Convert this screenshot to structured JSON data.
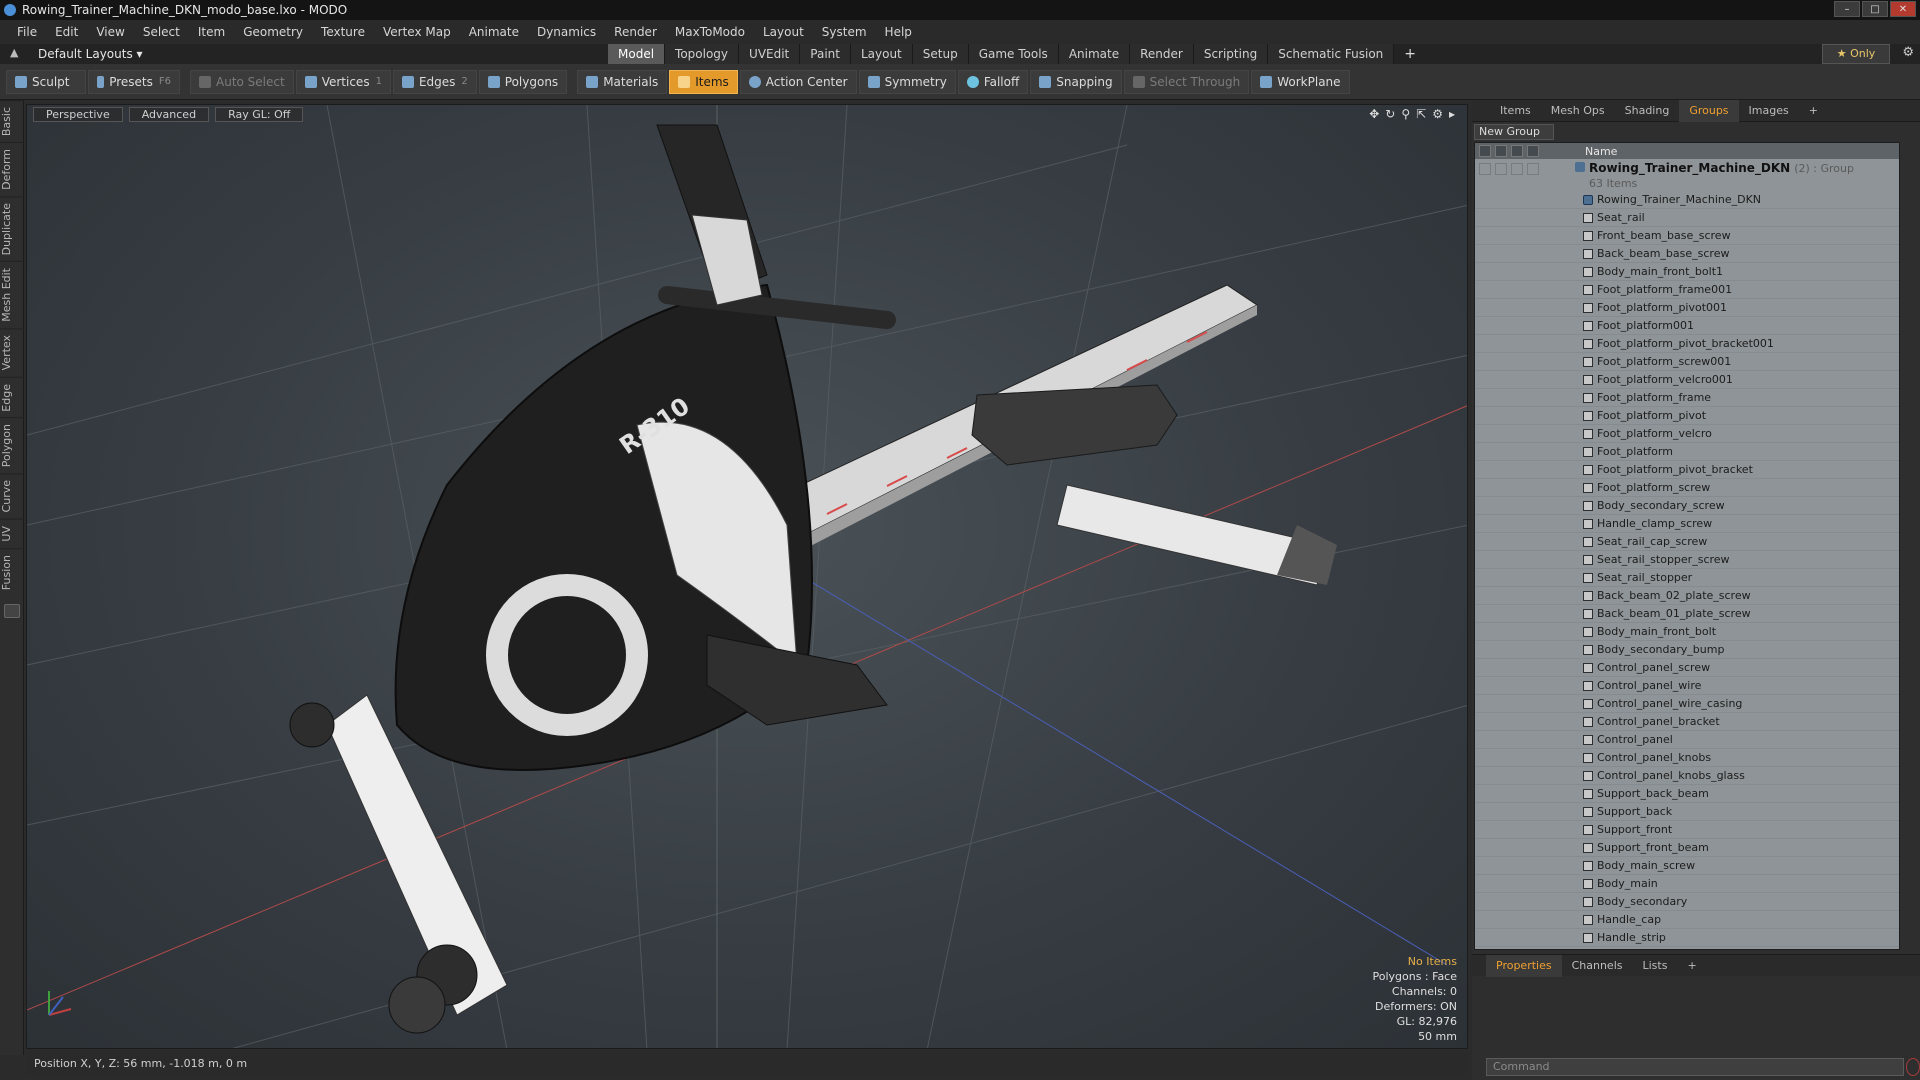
{
  "window": {
    "title": "Rowing_Trainer_Machine_DKN_modo_base.lxo - MODO"
  },
  "menu": [
    "File",
    "Edit",
    "View",
    "Select",
    "Item",
    "Geometry",
    "Texture",
    "Vertex Map",
    "Animate",
    "Dynamics",
    "Render",
    "MaxToModo",
    "Layout",
    "System",
    "Help"
  ],
  "layouts": {
    "current": "Default Layouts ▾",
    "tabs": [
      "Model",
      "Topology",
      "UVEdit",
      "Paint",
      "Layout",
      "Setup",
      "Game Tools",
      "Animate",
      "Render",
      "Scripting",
      "Schematic Fusion"
    ],
    "plus": "+",
    "only": "★ Only"
  },
  "toolbar": {
    "sculpt": "Sculpt",
    "presets": "Presets",
    "presets_key": "F6",
    "auto_select": "Auto Select",
    "vertices": "Vertices",
    "vertices_n": "1",
    "edges": "Edges",
    "edges_n": "2",
    "polygons": "Polygons",
    "materials": "Materials",
    "items": "Items",
    "action_center": "Action Center",
    "symmetry": "Symmetry",
    "falloff": "Falloff",
    "snapping": "Snapping",
    "select_through": "Select Through",
    "workplane": "WorkPlane"
  },
  "left_tools": [
    "Basic",
    "Deform",
    "Duplicate",
    "Mesh Edit",
    "Vertex",
    "Edge",
    "Polygon",
    "Curve",
    "UV",
    "Fusion"
  ],
  "viewport": {
    "view": "Perspective",
    "advanced": "Advanced",
    "raygl": "Ray GL: Off",
    "label_text": "R-310",
    "hud": {
      "no_items": "No Items",
      "polygons": "Polygons : Face",
      "channels": "Channels: 0",
      "deformers": "Deformers: ON",
      "gl": "GL: 82,976",
      "scale": "50 mm"
    }
  },
  "status": {
    "position": "Position X, Y, Z:  56 mm, -1.018 m, 0 m"
  },
  "right_panel": {
    "tabs": [
      "Items",
      "Mesh Ops",
      "Shading",
      "Groups",
      "Images"
    ],
    "active_tab": "Groups",
    "new_group": "New Group",
    "name_header": "Name",
    "root": {
      "name": "Rowing_Trainer_Machine_DKN",
      "meta": "(2) : Group",
      "sub": "63 Items"
    },
    "items": [
      "Rowing_Trainer_Machine_DKN",
      "Seat_rail",
      "Front_beam_base_screw",
      "Back_beam_base_screw",
      "Body_main_front_bolt1",
      "Foot_platform_frame001",
      "Foot_platform_pivot001",
      "Foot_platform001",
      "Foot_platform_pivot_bracket001",
      "Foot_platform_screw001",
      "Foot_platform_velcro001",
      "Foot_platform_frame",
      "Foot_platform_pivot",
      "Foot_platform_velcro",
      "Foot_platform",
      "Foot_platform_pivot_bracket",
      "Foot_platform_screw",
      "Body_secondary_screw",
      "Handle_clamp_screw",
      "Seat_rail_cap_screw",
      "Seat_rail_stopper_screw",
      "Seat_rail_stopper",
      "Back_beam_02_plate_screw",
      "Back_beam_01_plate_screw",
      "Body_main_front_bolt",
      "Body_secondary_bump",
      "Control_panel_screw",
      "Control_panel_wire",
      "Control_panel_wire_casing",
      "Control_panel_bracket",
      "Control_panel",
      "Control_panel_knobs",
      "Control_panel_knobs_glass",
      "Support_back_beam",
      "Support_back",
      "Support_front",
      "Support_front_beam",
      "Body_main_screw",
      "Body_main",
      "Body_secondary",
      "Handle_cap",
      "Handle_strip"
    ],
    "bottom_tabs": [
      "Properties",
      "Channels",
      "Lists"
    ],
    "active_bottom": "Properties",
    "command_placeholder": "Command"
  },
  "colors": {
    "accent": "#e39a2a",
    "tab_active": "#f0a030",
    "viewport_bg": "#373d43"
  }
}
